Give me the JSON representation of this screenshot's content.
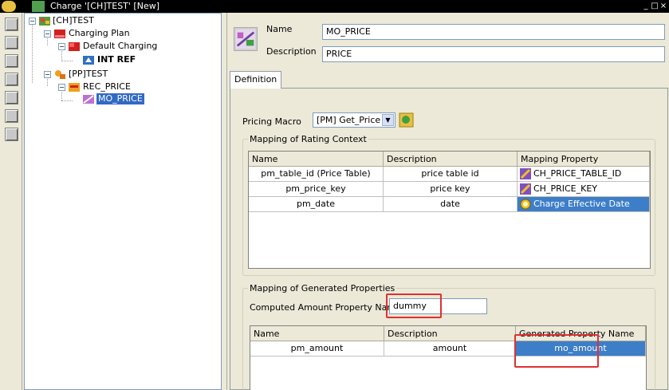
{
  "window": {
    "title": "Charge '[CH]TEST' [New]",
    "buttons": [
      "_",
      "□",
      "×"
    ]
  },
  "tree": {
    "nodes": [
      {
        "label": "[CH]TEST",
        "icon": "charge-icon"
      },
      {
        "label": "Charging Plan",
        "icon": "plan-icon"
      },
      {
        "label": "Default Charging",
        "icon": "charging-icon"
      },
      {
        "label": "INT REF",
        "icon": "ref-icon"
      },
      {
        "label": "[PP]TEST",
        "icon": "price-plan-icon"
      },
      {
        "label": "REC_PRICE",
        "icon": "recurring-icon"
      },
      {
        "label": "MO_PRICE",
        "icon": "macro-icon",
        "selected": true
      }
    ]
  },
  "header": {
    "name_label": "Name",
    "name_value": "MO_PRICE",
    "description_label": "Description",
    "description_value": "PRICE"
  },
  "tabs": [
    {
      "label": "Definition",
      "active": true
    }
  ],
  "pricing": {
    "label": "Pricing Macro",
    "value": "[PM] Get_Price"
  },
  "rating_context": {
    "title": "Mapping of Rating Context",
    "columns": [
      "Name",
      "Description",
      "Mapping Property"
    ],
    "rows": [
      {
        "name": "pm_table_id (Price Table)",
        "description": "price table id",
        "property": "CH_PRICE_TABLE_ID",
        "icon": "property-icon"
      },
      {
        "name": "pm_price_key",
        "description": "price key",
        "property": "CH_PRICE_KEY",
        "icon": "property-icon"
      },
      {
        "name": "pm_date",
        "description": "date",
        "property": "Charge Effective Date",
        "icon": "date-icon",
        "selected": true
      }
    ]
  },
  "generated": {
    "title": "Mapping of Generated Properties",
    "computed_label": "Computed Amount Property Name",
    "computed_value": "dummy",
    "columns": [
      "Name",
      "Description",
      "Generated Property Name"
    ],
    "rows": [
      {
        "name": "pm_amount",
        "description": "amount",
        "property": "mo_amount",
        "selected": true
      }
    ]
  },
  "colors": {
    "selection": "#3d7ec9",
    "highlight": "#e03030"
  }
}
